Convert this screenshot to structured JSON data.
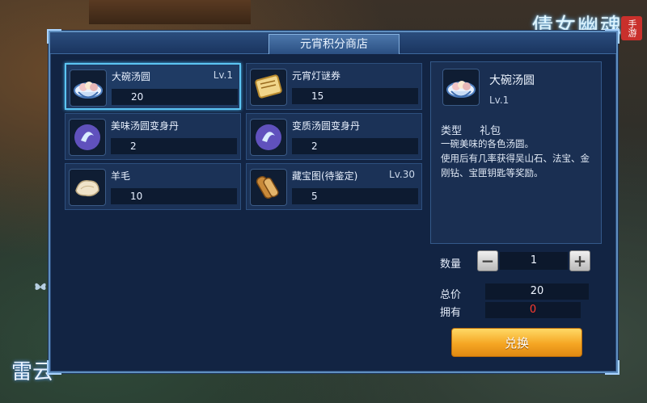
{
  "panel": {
    "title": "元宵积分商店"
  },
  "logos": {
    "game": "倩女幽魂",
    "game_sub": "手游",
    "brand": "雷云"
  },
  "items": [
    {
      "name": "大碗汤圆",
      "level": "Lv.1",
      "price": "20",
      "icon": "rice-ball-bowl-icon",
      "selected": true
    },
    {
      "name": "元宵灯谜券",
      "level": "",
      "price": "15",
      "icon": "lantern-riddle-ticket-icon",
      "selected": false
    },
    {
      "name": "美味汤圆变身丹",
      "level": "",
      "price": "2",
      "icon": "transformation-pill-icon",
      "selected": false
    },
    {
      "name": "变质汤圆变身丹",
      "level": "",
      "price": "2",
      "icon": "transformation-pill-icon",
      "selected": false
    },
    {
      "name": "羊毛",
      "level": "",
      "price": "10",
      "icon": "wool-icon",
      "selected": false
    },
    {
      "name": "藏宝图(待鉴定)",
      "level": "Lv.30",
      "price": "5",
      "icon": "treasure-map-icon",
      "selected": false
    }
  ],
  "detail": {
    "name": "大碗汤圆",
    "level": "Lv.1",
    "type_label": "类型",
    "type_value": "礼包",
    "description": "一碗美味的各色汤圆。\n使用后有几率获得吴山石、法宝、金刚钻、宝匣钥匙等奖励。"
  },
  "purchase": {
    "qty_label": "数量",
    "qty_value": "1",
    "total_label": "总价",
    "total_value": "20",
    "owned_label": "拥有",
    "owned_value": "0",
    "exchange_label": "兑换"
  },
  "colors": {
    "accent": "#5cc4f2",
    "button": "#f5a623",
    "owned_warning": "#ff3b30"
  }
}
